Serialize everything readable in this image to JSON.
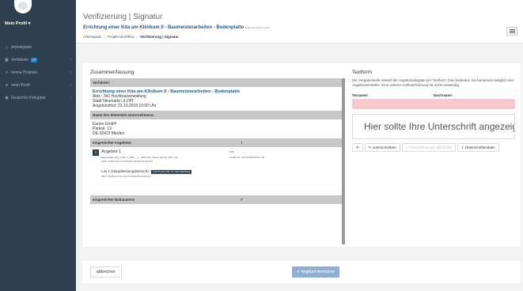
{
  "sidebar": {
    "profile_name": "Mein Profil ▾",
    "items": [
      {
        "label": "Arbeitsplatz",
        "icon": "home-icon",
        "badge": ""
      },
      {
        "label": "Verfahren",
        "icon": "grid-icon",
        "badge": "17"
      },
      {
        "label": "meine Projekte",
        "icon": "list-icon",
        "badge": ""
      },
      {
        "label": "mein Profil",
        "icon": "user-icon",
        "badge": ""
      },
      {
        "label": "Deutsche eVergabe",
        "icon": "globe-icon",
        "badge": ""
      }
    ]
  },
  "header": {
    "title": "Verifizierung | Signatur",
    "subtitle": "Errichtung einer Kita am Klinikum II - Baumeisterarbeiten - Bodenplatte",
    "subtitle_small": "Stadt Neumarkt i.d.OPf.",
    "breadcrumb": [
      "Arbeitsplatz",
      "Projekt-Workflow",
      "Verifizierung | Signatur"
    ]
  },
  "summary": {
    "title": "Zusammenfassung",
    "procedure_header": "Verfahren:",
    "procedure_title": "Errichtung einer Kita am Klinikum II - Baumeisterarbeiten - Bodenplatte",
    "procedure_lines": [
      "Aktz.: 341 Hochbauverwaltung",
      "Stadt Neumarkt i.d.OPf.",
      "Angebotsfrist: 23.10.2018 10:00 Uhr"
    ],
    "bidder_header": "Name des bietenden Unternehmens:",
    "bidder_lines": [
      "Eurios GmbH",
      "Parkstr. 13",
      "DE-32423 Minden"
    ],
    "offers_header": "eingereichte Angebote:",
    "offers_count": "1",
    "offer": {
      "number": "1",
      "title": "Angebot 1",
      "file": "Eigenerklaerung_VOB_A_2016_-_1._Abschnitt_Stand_Januar_2017.pdf",
      "hash": "MD5: 3C862A601C4108E28FF5548A9E14E4DE",
      "from_label": "von:",
      "from_value": "...",
      "date": "erstellt am: 16.10.2018 09:33 Uhr"
    },
    "lot": {
      "title": "Los 1 (Hauptleistungsbereich):",
      "badge": "1,00 € netto inkl. 0= ohne Nachtrag",
      "hash": "MD5: 2B1BF01CA0C0E3A419EA58A00A9E42"
    },
    "docs_header": "eingereichte Dokumente:",
    "docs_count": "0"
  },
  "textform": {
    "title": "Textform",
    "description": "Die Vergabestelle erlaubt die Angebotsabgabe per Textform. Das bedeutet, Sie benennen lediglich den Angebotsersteller. Eine weitere Authentifizierung ist nicht notwendig.",
    "firstname_label": "Vorname:",
    "firstname_value": "",
    "lastname_label": "Nachname:",
    "lastname_value": "",
    "signature_placeholder": "Hier sollte Ihre Unterschrift angezeigt werden ...",
    "buttons": {
      "refresh": "",
      "write": "unterschreiben",
      "smartphone": "Smartphone per QR-Code",
      "file": "Unterschriftendatei"
    }
  },
  "footer": {
    "cancel_label": "abbrechen",
    "submit_label": "Angebot einreichen"
  },
  "colors": {
    "sidebar_bg": "#2f4050",
    "accent": "#1c84c6",
    "title_blue": "#1a5c8f",
    "required_field": "#f8c8cc",
    "submit_disabled": "#8fb0d4"
  }
}
